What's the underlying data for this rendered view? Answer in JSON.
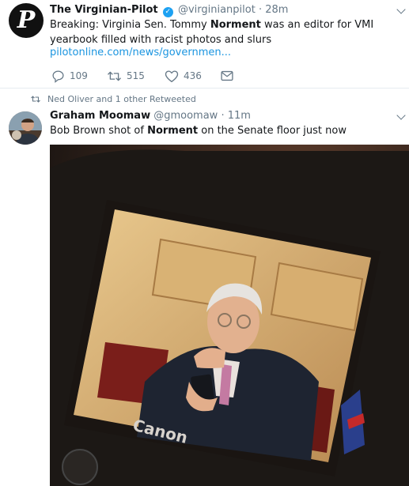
{
  "tweet1": {
    "name": "The Virginian-Pilot",
    "handle": "@virginianpilot",
    "dot": "·",
    "time": "28m",
    "text_before": "Breaking: Virginia Sen. Tommy ",
    "text_bold": "Norment",
    "text_after": " was an editor for VMI yearbook filled with racist photos and slurs",
    "link": "pilotonline.com/news/governmen...",
    "avatar_glyph": "P",
    "replies": "109",
    "retweets": "515",
    "likes": "436"
  },
  "retweeted_by": "Ned Oliver and 1 other Retweeted",
  "tweet2": {
    "name": "Graham Moomaw",
    "handle": "@gmoomaw",
    "dot": "·",
    "time": "11m",
    "text_before": "Bob Brown shot of ",
    "text_bold": "Norment",
    "text_after": " on the Senate floor just now",
    "camera_brand": "Canon"
  },
  "colors": {
    "link": "#1b95e0",
    "verified": "#1da1f2",
    "muted": "#657786"
  },
  "icons": [
    "verified-icon",
    "reply-icon",
    "retweet-icon",
    "like-icon",
    "message-icon",
    "chevron-down-icon",
    "retweeted-icon"
  ]
}
